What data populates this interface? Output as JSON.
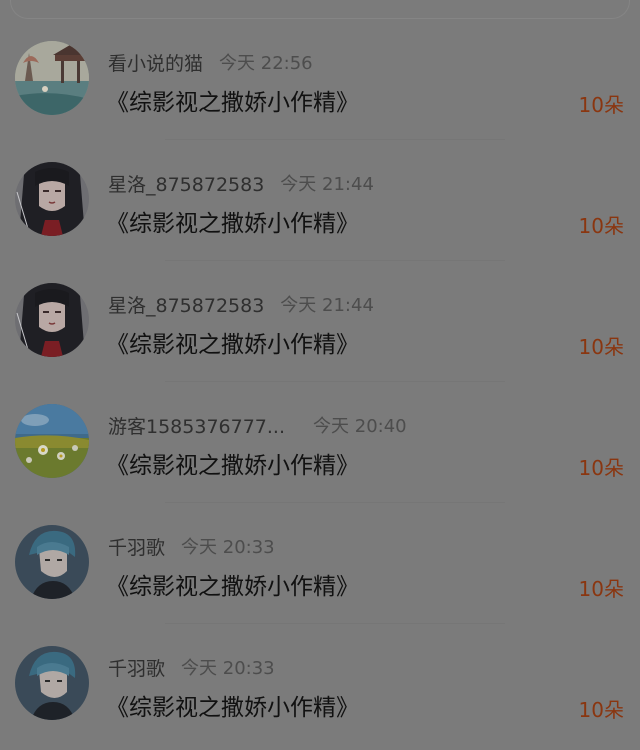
{
  "comments": [
    {
      "username": "看小说的猫",
      "time": "今天 22:56",
      "book": "《综影视之撒娇小作精》",
      "gift": "10朵",
      "avatar": "landscape-avatar-icon"
    },
    {
      "username": "星洛_875872583",
      "time": "今天 21:44",
      "book": "《综影视之撒娇小作精》",
      "gift": "10朵",
      "avatar": "dark-hair-girl-avatar-icon"
    },
    {
      "username": "星洛_875872583",
      "time": "今天 21:44",
      "book": "《综影视之撒娇小作精》",
      "gift": "10朵",
      "avatar": "dark-hair-girl-avatar-icon"
    },
    {
      "username": "游客1585376777...",
      "time": "今天 20:40",
      "book": "《综影视之撒娇小作精》",
      "gift": "10朵",
      "avatar": "flower-field-avatar-icon"
    },
    {
      "username": "千羽歌",
      "time": "今天 20:33",
      "book": "《综影视之撒娇小作精》",
      "gift": "10朵",
      "avatar": "blue-hair-boy-avatar-icon"
    },
    {
      "username": "千羽歌",
      "time": "今天 20:33",
      "book": "《综影视之撒娇小作精》",
      "gift": "10朵",
      "avatar": "blue-hair-boy-avatar-icon"
    }
  ],
  "colors": {
    "background": "#7b7b7b",
    "gift_accent": "#8a3610"
  }
}
